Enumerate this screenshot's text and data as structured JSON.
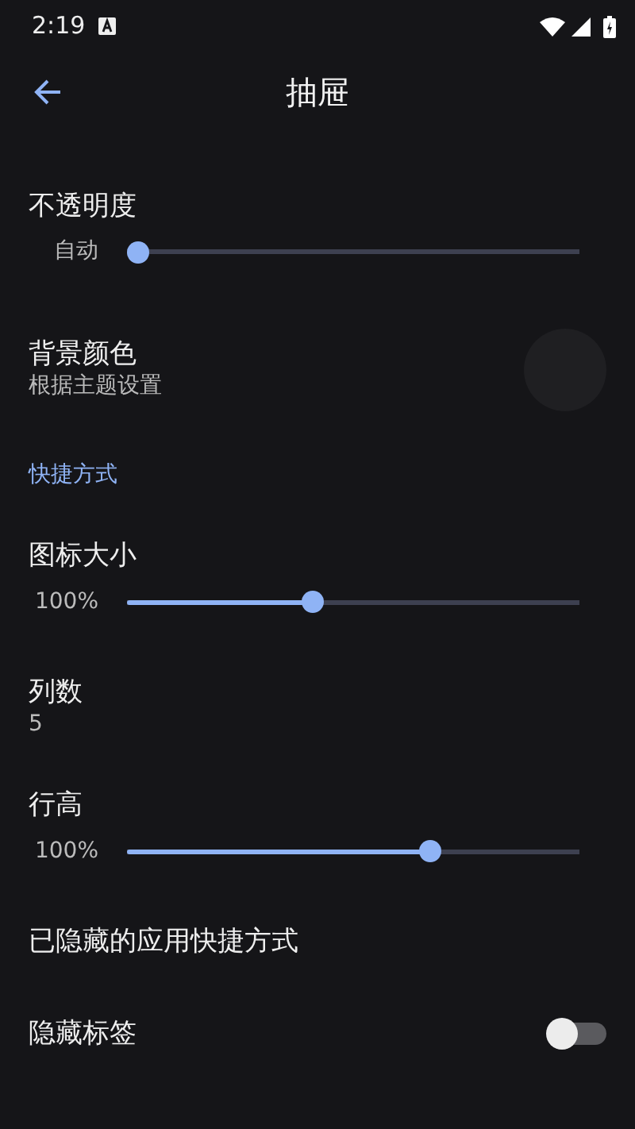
{
  "status_bar": {
    "time": "2:19"
  },
  "app_bar": {
    "title": "抽屉"
  },
  "settings": [
    {
      "kind": "slider",
      "title": "不透明度",
      "reading": "自动",
      "level": 0
    },
    {
      "kind": "color",
      "title": "背景颜色",
      "summary": "根据主题设置"
    },
    {
      "kind": "header",
      "title": "快捷方式"
    },
    {
      "kind": "slider",
      "title": "图标大小",
      "reading": "100%",
      "level": 0.41
    },
    {
      "kind": "text",
      "title": "列数",
      "summary": "5"
    },
    {
      "kind": "slider",
      "title": "行高",
      "reading": "100%",
      "level": 0.67
    },
    {
      "kind": "text",
      "title": "已隐藏的应用快捷方式"
    },
    {
      "kind": "switch",
      "title": "隐藏标签",
      "on": false
    }
  ]
}
